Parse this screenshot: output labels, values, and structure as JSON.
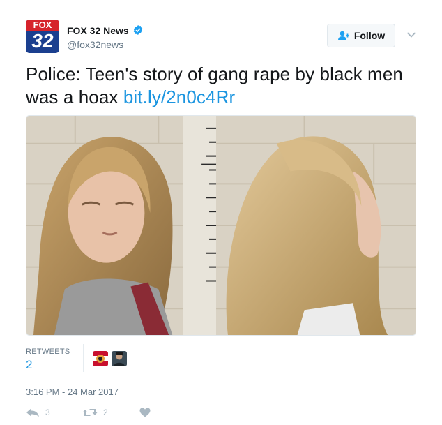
{
  "account": {
    "name": "FOX 32 News",
    "handle": "@fox32news",
    "avatar_text_top": "FOX",
    "avatar_text_bottom": "32",
    "verified": true
  },
  "follow_label": "Follow",
  "tweet": {
    "text": "Police: Teen's story of gang rape by black men was a hoax",
    "link": "bit.ly/2n0c4Rr"
  },
  "stats": {
    "retweets_label": "RETWEETS",
    "retweets_count": "2"
  },
  "timestamp": "3:16 PM - 24 Mar 2017",
  "actions": {
    "reply_count": "3",
    "retweet_count": "2"
  },
  "colors": {
    "link": "#1b95e0",
    "muted": "#657786",
    "verified": "#1da1f2"
  }
}
